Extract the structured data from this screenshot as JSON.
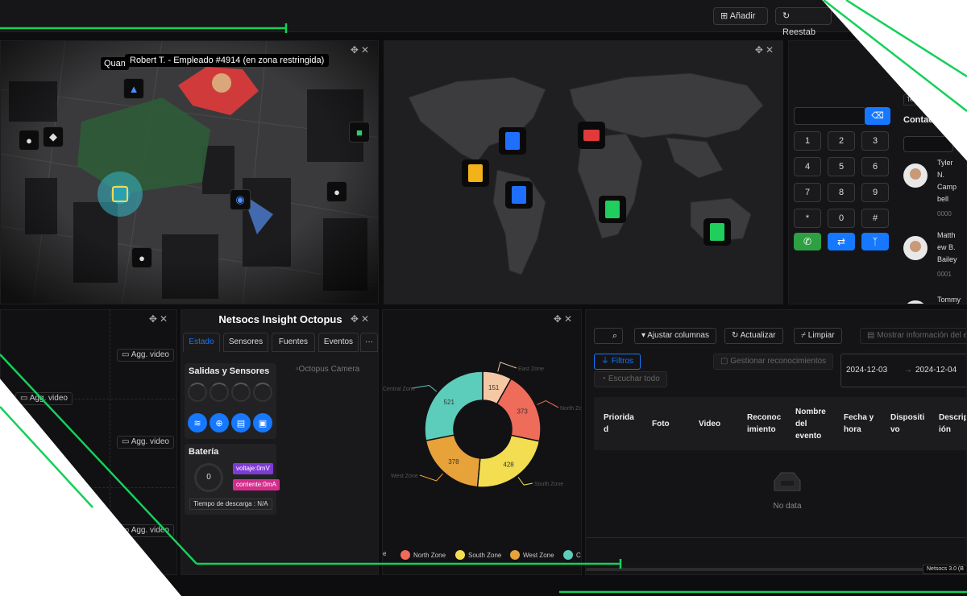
{
  "toolbar": {
    "add_label": "Añadir",
    "reset_label": "Reestab"
  },
  "map3d": {
    "tooltip_quan": "Quan",
    "tooltip_alert": "Robert T. - Empleado #4914 (en zona restringida)"
  },
  "dialer": {
    "keys": [
      "1",
      "2",
      "3",
      "4",
      "5",
      "6",
      "7",
      "8",
      "9",
      "*",
      "0",
      "#"
    ],
    "tele_label": "Tele",
    "contacts_title": "Contactos",
    "contacts": [
      {
        "name_lines": [
          "Tyler",
          "N.",
          "Camp",
          "bell"
        ],
        "ext": "0000"
      },
      {
        "name_lines": [
          "Matth",
          "ew B.",
          "Bailey"
        ],
        "ext": "0001"
      },
      {
        "name_lines": [
          "Tommy"
        ],
        "ext": ""
      }
    ]
  },
  "video": {
    "add_video_label": "Agg. video"
  },
  "insight": {
    "title": "Netsocs Insight Octopus",
    "tabs": [
      "Estado",
      "Sensores",
      "Fuentes",
      "Eventos",
      "···"
    ],
    "io_title": "Salidas y Sensores",
    "camera_alt": "Octopus Camera",
    "battery_title": "Batería",
    "battery_value": "0",
    "voltage_label": "voltaje:0mV",
    "current_label": "corriente:0mA",
    "discharge_label": "Tiempo de descarga : N/A"
  },
  "chart_data": {
    "type": "pie",
    "categories": [
      "East Zone",
      "North Zone",
      "South Zone",
      "West Zone",
      "Central Zone"
    ],
    "values": [
      151,
      373,
      428,
      378,
      521
    ],
    "colors": [
      "#f4c7a5",
      "#ef6b5a",
      "#f3de52",
      "#e7a23a",
      "#5ccdba"
    ]
  },
  "legend_partial": {
    "first": "e",
    "last": "C"
  },
  "events": {
    "adjust_label": "Ajustar columnas",
    "refresh_label": "Actualizar",
    "clear_label": "Limpiar",
    "show_info_label": "Mostrar información del e",
    "filters_label": "Filtros",
    "listen_label": "Escuchar todo",
    "manage_label": "Gestionar reconocimientos",
    "date_from": "2024-12-03",
    "date_arrow": "→",
    "date_to": "2024-12-04",
    "columns": [
      {
        "lines": [
          "Priorida",
          "d"
        ]
      },
      {
        "lines": [
          "Foto"
        ]
      },
      {
        "lines": [
          "Video"
        ]
      },
      {
        "lines": [
          "Reconoc",
          "imiento"
        ]
      },
      {
        "lines": [
          "Nombre",
          "del",
          "evento"
        ]
      },
      {
        "lines": [
          "Fecha y",
          "hora"
        ]
      },
      {
        "lines": [
          "Dispositi",
          "vo"
        ]
      },
      {
        "lines": [
          "Descrip",
          "ión"
        ]
      }
    ],
    "empty_text": "No data",
    "version_badge": "Netsocs 3.0 (B"
  },
  "colors": {
    "accent_green": "#14d05a",
    "primary_blue": "#1677ff"
  }
}
